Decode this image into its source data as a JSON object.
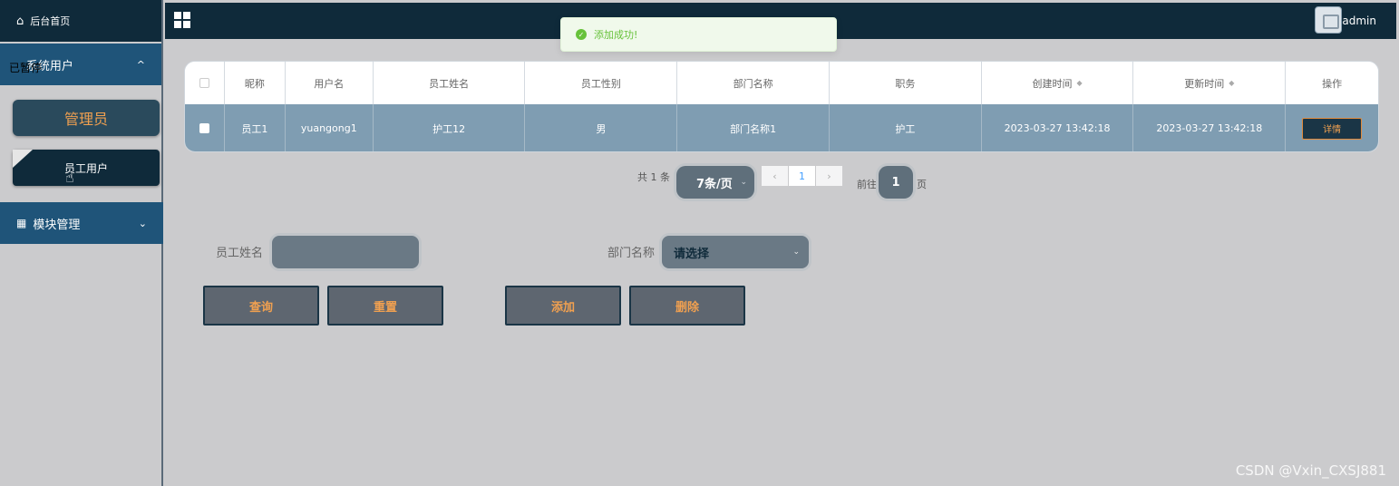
{
  "sidebar": {
    "home_label": "后台首页",
    "paused_label": "已暂停",
    "system_users": "系统用户",
    "admin_label": "管理员",
    "staff_users_label": "员工用户",
    "module_mgmt": "模块管理"
  },
  "header": {
    "title": "",
    "username": "admin"
  },
  "toast": {
    "message": "添加成功!"
  },
  "table": {
    "headers": [
      "昵称",
      "用户名",
      "员工姓名",
      "员工性别",
      "部门名称",
      "职务",
      "创建时间",
      "更新时间",
      "操作"
    ],
    "rows": [
      {
        "nickname": "员工1",
        "username": "yuangong1",
        "name": "护工12",
        "gender": "男",
        "department": "部门名称1",
        "position": "护工",
        "created": "2023-03-27 13:42:18",
        "updated": "2023-03-27 13:42:18",
        "action": "详情"
      }
    ]
  },
  "pagination": {
    "total": "共 1 条",
    "page_size": "7条/页",
    "current_page": "1",
    "goto_prefix": "前往",
    "goto_value": "1",
    "goto_suffix": "页",
    "prev": "‹",
    "next": "›"
  },
  "form": {
    "name_label": "员工姓名",
    "dept_label": "部门名称",
    "dept_placeholder": "请选择",
    "query": "查询",
    "reset": "重置",
    "add": "添加",
    "delete": "删除"
  },
  "watermark": "CSDN @Vxin_CXSJ881"
}
